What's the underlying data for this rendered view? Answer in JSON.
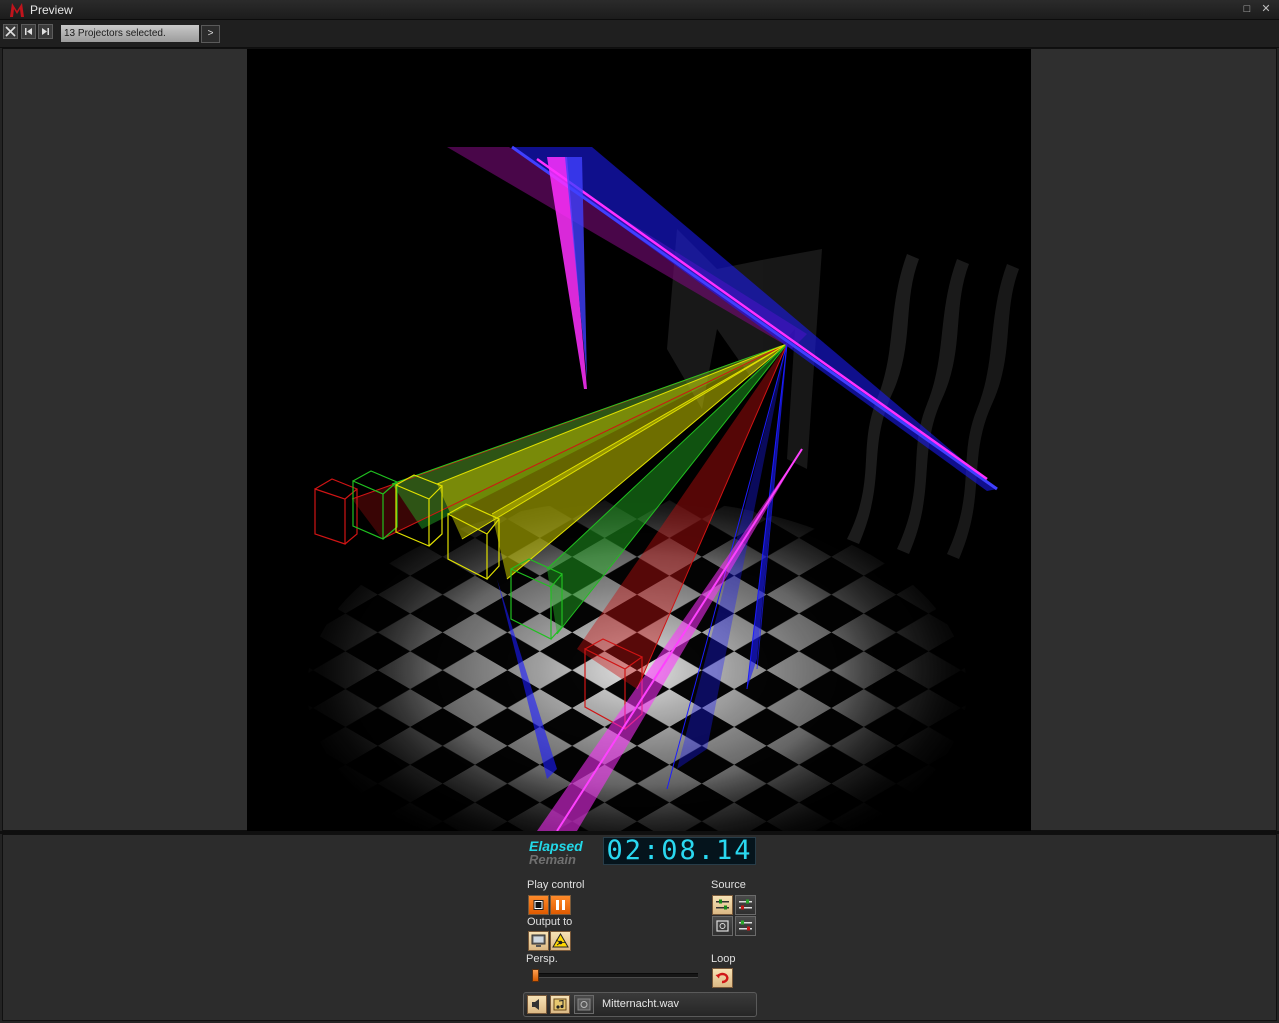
{
  "window": {
    "title": "Preview",
    "maximize_glyph": "□",
    "close_glyph": "✕"
  },
  "toolbar": {
    "status_text": "13 Projectors selected.",
    "arrow_label": ">"
  },
  "timer": {
    "elapsed_label": "Elapsed",
    "remain_label": "Remain",
    "time": "02:08.14"
  },
  "controls": {
    "play_control_label": "Play control",
    "output_to_label": "Output to",
    "persp_label": "Persp.",
    "source_label": "Source",
    "loop_label": "Loop",
    "persp_value": 0.0
  },
  "file": {
    "name": "Mitternacht.wav"
  },
  "colors": {
    "accent_orange": "#ff7a1a",
    "timer_cyan": "#2ad8f0",
    "beam_magenta": "#ff22ff",
    "beam_blue": "#1c1cff",
    "beam_yellow": "#e6e600",
    "beam_green": "#10d010",
    "beam_red": "#e01010"
  }
}
